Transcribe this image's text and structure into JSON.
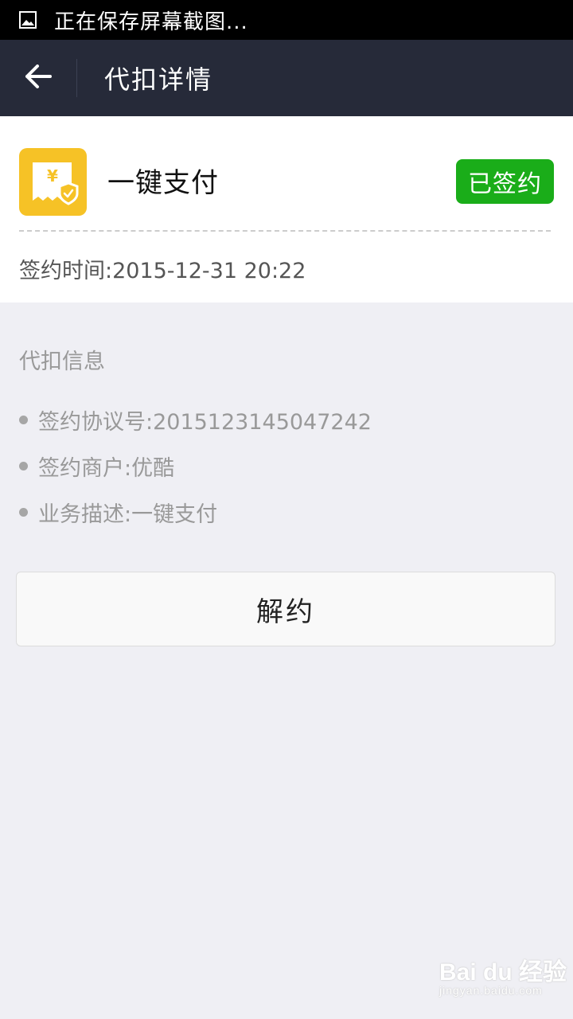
{
  "status_bar": {
    "text": "正在保存屏幕截图...",
    "icon": "image-icon"
  },
  "nav": {
    "title": "代扣详情",
    "back_icon": "back-arrow-icon"
  },
  "card": {
    "app_name": "一键支付",
    "app_icon": "receipt-shield-icon",
    "status_badge": "已签约",
    "sign_time": "签约时间:2015-12-31 20:22",
    "colors": {
      "icon_bg": "#f6c226",
      "badge_bg": "#1aad19"
    }
  },
  "info": {
    "section_title": "代扣信息",
    "items": [
      "签约协议号:2015123145047242",
      "签约商户:优酷",
      "业务描述:一键支付"
    ]
  },
  "actions": {
    "unbind_label": "解约"
  },
  "watermark": {
    "brand": "Bai du 经验",
    "url": "jingyan.baidu.com"
  }
}
